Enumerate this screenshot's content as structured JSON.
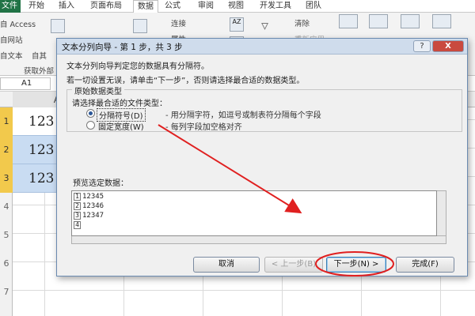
{
  "excel": {
    "tabs": [
      "文件",
      "开始",
      "插入",
      "页面布局",
      "数据",
      "公式",
      "审阅",
      "视图",
      "开发工具",
      "团队"
    ],
    "active_tab": "数据",
    "ribbon": {
      "access": "自 Access",
      "web": "自网站",
      "text": "自文本",
      "other": "自其",
      "get_external_group": "获取外部",
      "connections": "连接",
      "attributes": "属性",
      "sort_az": "AZ",
      "sort_za": "ZA",
      "clear": "清除",
      "reapply": "重新应用"
    },
    "name_box": "A1",
    "column_a": "A",
    "rows": [
      "1",
      "2",
      "3",
      "4",
      "5",
      "6",
      "7"
    ],
    "cells": [
      "123",
      "123",
      "123"
    ]
  },
  "dialog": {
    "title": "文本分列向导 - 第 1 步，共 3 步",
    "help_label": "?",
    "close_label": "X",
    "line1": "文本分列向导判定您的数据具有分隔符。",
    "line2": "若一切设置无误，请单击“下一步”，否则请选择最合适的数据类型。",
    "group_title": "原始数据类型",
    "group_prompt": "请选择最合适的文件类型：",
    "option1_label": "分隔符号(D)",
    "option1_desc": "- 用分隔字符，如逗号或制表符分隔每个字段",
    "option2_label": "固定宽度(W)",
    "option2_desc": "- 每列字段加空格对齐",
    "selected_option": "分隔符号(D)",
    "preview_label": "预览选定数据：",
    "preview_lines": [
      {
        "num": "1",
        "text": "12345"
      },
      {
        "num": "2",
        "text": "12346"
      },
      {
        "num": "3",
        "text": "12347"
      },
      {
        "num": "4",
        "text": ""
      }
    ],
    "buttons": {
      "cancel": "取消",
      "back": "< 上一步(B)",
      "next": "下一步(N) >",
      "finish": "完成(F)"
    }
  },
  "annotation_color": "#e02020"
}
